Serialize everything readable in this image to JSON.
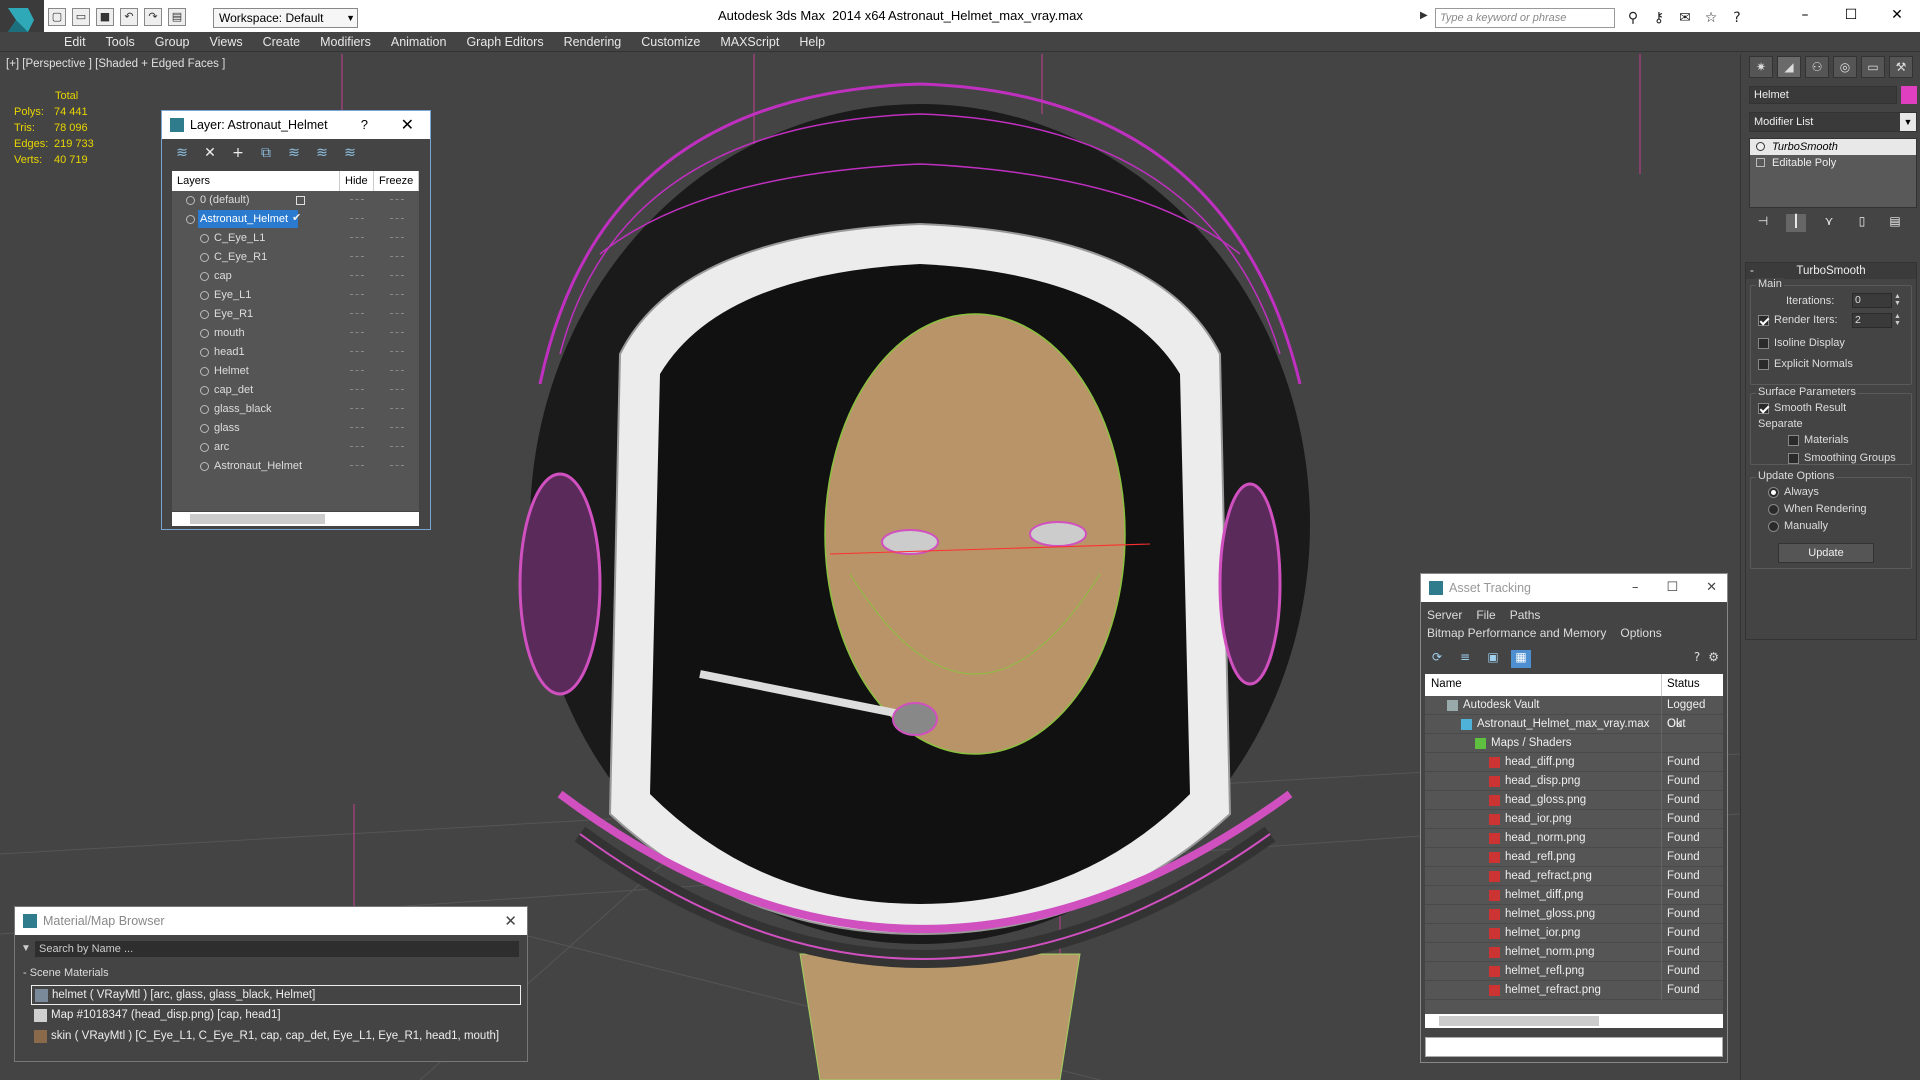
{
  "app": {
    "title": "Autodesk 3ds Max  2014 x64",
    "file": "Astronaut_Helmet_max_vray.max",
    "workspace": "Workspace: Default",
    "search_placeholder": "Type a keyword or phrase"
  },
  "menu": [
    "Edit",
    "Tools",
    "Group",
    "Views",
    "Create",
    "Modifiers",
    "Animation",
    "Graph Editors",
    "Rendering",
    "Customize",
    "MAXScript",
    "Help"
  ],
  "viewport": {
    "label": "[+] [Perspective ] [Shaded + Edged Faces ]",
    "stats": {
      "header": "Total",
      "rows": [
        {
          "label": "Polys:",
          "value": "74 441"
        },
        {
          "label": "Tris:",
          "value": "78 096"
        },
        {
          "label": "Edges:",
          "value": "219 733"
        },
        {
          "label": "Verts:",
          "value": "40 719"
        }
      ]
    }
  },
  "layer_window": {
    "title": "Layer: Astronaut_Helmet",
    "help": "?",
    "columns": [
      "Layers",
      "Hide",
      "Freeze"
    ],
    "rows": [
      {
        "name": "0 (default)",
        "level": 0,
        "selected": false
      },
      {
        "name": "Astronaut_Helmet",
        "level": 0,
        "selected": true
      },
      {
        "name": "C_Eye_L1",
        "level": 1,
        "selected": false
      },
      {
        "name": "C_Eye_R1",
        "level": 1,
        "selected": false
      },
      {
        "name": "cap",
        "level": 1,
        "selected": false
      },
      {
        "name": "Eye_L1",
        "level": 1,
        "selected": false
      },
      {
        "name": "Eye_R1",
        "level": 1,
        "selected": false
      },
      {
        "name": "mouth",
        "level": 1,
        "selected": false
      },
      {
        "name": "head1",
        "level": 1,
        "selected": false
      },
      {
        "name": "Helmet",
        "level": 1,
        "selected": false
      },
      {
        "name": "cap_det",
        "level": 1,
        "selected": false
      },
      {
        "name": "glass_black",
        "level": 1,
        "selected": false
      },
      {
        "name": "glass",
        "level": 1,
        "selected": false
      },
      {
        "name": "arc",
        "level": 1,
        "selected": false
      },
      {
        "name": "Astronaut_Helmet",
        "level": 1,
        "selected": false
      }
    ]
  },
  "material_browser": {
    "title": "Material/Map Browser",
    "search_placeholder": "Search by Name ...",
    "section": "- Scene Materials",
    "items": [
      {
        "label": "helmet  ( VRayMtl ) [arc, glass, glass_black, Helmet]",
        "swatch": "#7a8a9a",
        "selected": true
      },
      {
        "label": "Map #1018347 (head_disp.png) [cap, head1]",
        "swatch": "#cfcfcf",
        "selected": false
      },
      {
        "label": "skin  ( VRayMtl ) [C_Eye_L1, C_Eye_R1, cap, cap_det, Eye_L1, Eye_R1, head1, mouth]",
        "swatch": "#8a6a4a",
        "selected": false
      }
    ]
  },
  "asset_tracking": {
    "title": "Asset Tracking",
    "menu_row1": [
      "Server",
      "File",
      "Paths"
    ],
    "menu_row2": [
      "Bitmap Performance and Memory",
      "Options"
    ],
    "columns": [
      "Name",
      "Status"
    ],
    "rows": [
      {
        "name": "Autodesk Vault",
        "status": "Logged Out",
        "level": 0,
        "icon": "vault"
      },
      {
        "name": "Astronaut_Helmet_max_vray.max",
        "status": "Ok",
        "level": 1,
        "icon": "max"
      },
      {
        "name": "Maps / Shaders",
        "status": "",
        "level": 2,
        "icon": "folder"
      },
      {
        "name": "head_diff.png",
        "status": "Found",
        "level": 3,
        "icon": "png"
      },
      {
        "name": "head_disp.png",
        "status": "Found",
        "level": 3,
        "icon": "png"
      },
      {
        "name": "head_gloss.png",
        "status": "Found",
        "level": 3,
        "icon": "png"
      },
      {
        "name": "head_ior.png",
        "status": "Found",
        "level": 3,
        "icon": "png"
      },
      {
        "name": "head_norm.png",
        "status": "Found",
        "level": 3,
        "icon": "png"
      },
      {
        "name": "head_refl.png",
        "status": "Found",
        "level": 3,
        "icon": "png"
      },
      {
        "name": "head_refract.png",
        "status": "Found",
        "level": 3,
        "icon": "png"
      },
      {
        "name": "helmet_diff.png",
        "status": "Found",
        "level": 3,
        "icon": "png"
      },
      {
        "name": "helmet_gloss.png",
        "status": "Found",
        "level": 3,
        "icon": "png"
      },
      {
        "name": "helmet_ior.png",
        "status": "Found",
        "level": 3,
        "icon": "png"
      },
      {
        "name": "helmet_norm.png",
        "status": "Found",
        "level": 3,
        "icon": "png"
      },
      {
        "name": "helmet_refl.png",
        "status": "Found",
        "level": 3,
        "icon": "png"
      },
      {
        "name": "helmet_refract.png",
        "status": "Found",
        "level": 3,
        "icon": "png"
      }
    ]
  },
  "command_panel": {
    "object_name": "Helmet",
    "object_color": "#e040c0",
    "modifier_list": "Modifier List",
    "stack": [
      "TurboSmooth",
      "Editable Poly"
    ],
    "rollout_title": "TurboSmooth",
    "main_group": "Main",
    "iterations_label": "Iterations:",
    "iterations_value": "0",
    "render_iters_label": "Render Iters:",
    "render_iters_value": "2",
    "isoline_label": "Isoline Display",
    "explicit_normals_label": "Explicit Normals",
    "surface_group": "Surface Parameters",
    "smooth_result_label": "Smooth Result",
    "separate_label": "Separate",
    "materials_label": "Materials",
    "smoothing_groups_label": "Smoothing Groups",
    "update_group": "Update Options",
    "always_label": "Always",
    "when_rendering_label": "When Rendering",
    "manually_label": "Manually",
    "update_button": "Update"
  }
}
